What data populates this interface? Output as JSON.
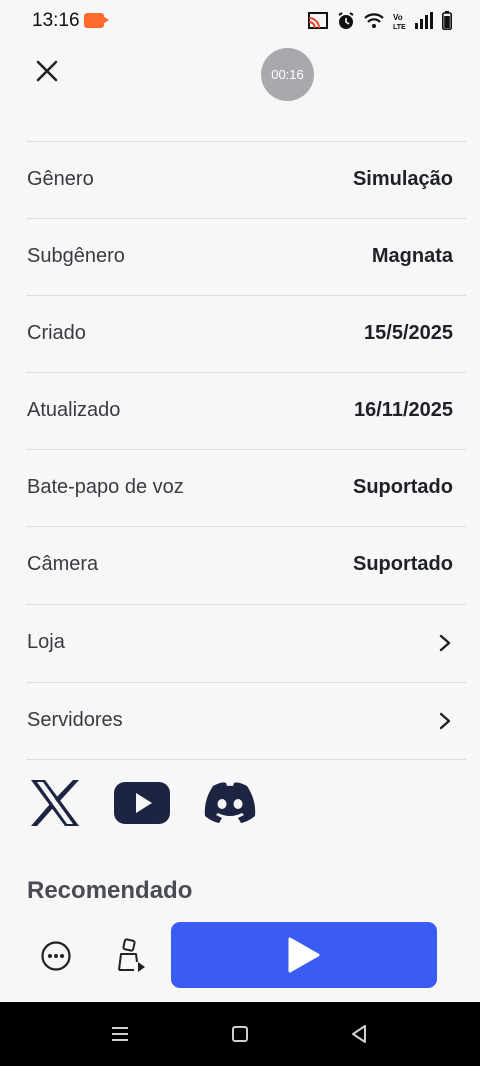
{
  "status_bar": {
    "time": "13:16",
    "icons": [
      "screen-record-icon",
      "cast-icon",
      "alarm-icon",
      "wifi-icon",
      "volte-icon",
      "signal-icon",
      "battery-icon"
    ]
  },
  "header": {
    "timer": "00:16",
    "close_icon": "close-icon"
  },
  "details": [
    {
      "label": "Gênero",
      "value": "Simulação"
    },
    {
      "label": "Subgênero",
      "value": "Magnata"
    },
    {
      "label": "Criado",
      "value": "15/5/2025"
    },
    {
      "label": "Atualizado",
      "value": "16/11/2025"
    },
    {
      "label": "Bate-papo de voz",
      "value": "Suportado"
    },
    {
      "label": "Câmera",
      "value": "Suportado"
    },
    {
      "label": "Loja",
      "value": null,
      "icon": "chevron-right-icon"
    },
    {
      "label": "Servidores",
      "value": null,
      "icon": "chevron-right-icon"
    }
  ],
  "socials": [
    "x-logo-icon",
    "youtube-icon",
    "discord-icon"
  ],
  "section_title": "Recomendado",
  "bottom_bar": {
    "more_icon": "more-options-icon",
    "avatar_icon": "avatar-icon",
    "play_icon": "play-icon"
  },
  "nav_bar": [
    "menu-icon",
    "home-icon",
    "back-icon"
  ],
  "colors": {
    "accent": "#3a5cf2",
    "social_dark": "#1d2442",
    "background": "#f7f7f8",
    "divider": "#dddde0"
  }
}
